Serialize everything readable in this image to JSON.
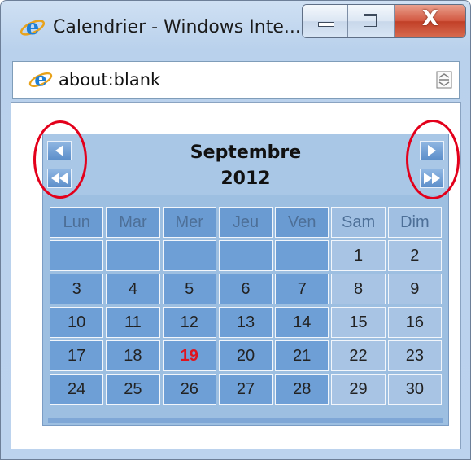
{
  "window": {
    "title": "Calendrier - Windows Inte...",
    "close_glyph": "X"
  },
  "address": {
    "url": "about:blank"
  },
  "calendar": {
    "month": "Septembre",
    "year": "2012",
    "weekdays": [
      "Lun",
      "Mar",
      "Mer",
      "Jeu",
      "Ven",
      "Sam",
      "Dim"
    ],
    "weeks": [
      [
        "",
        "",
        "",
        "",
        "",
        "1",
        "2"
      ],
      [
        "3",
        "4",
        "5",
        "6",
        "7",
        "8",
        "9"
      ],
      [
        "10",
        "11",
        "12",
        "13",
        "14",
        "15",
        "16"
      ],
      [
        "17",
        "18",
        "19",
        "20",
        "21",
        "22",
        "23"
      ],
      [
        "24",
        "25",
        "26",
        "27",
        "28",
        "29",
        "30"
      ]
    ],
    "today": "19",
    "today_color": "#e0141e"
  },
  "icons": {
    "browser": "ie-logo-icon",
    "compat": "compatibility-view-icon",
    "prev_month": "triangle-left-icon",
    "prev_year": "double-triangle-left-icon",
    "next_month": "triangle-right-icon",
    "next_year": "double-triangle-right-icon"
  },
  "annotation_color": "#e3001b"
}
